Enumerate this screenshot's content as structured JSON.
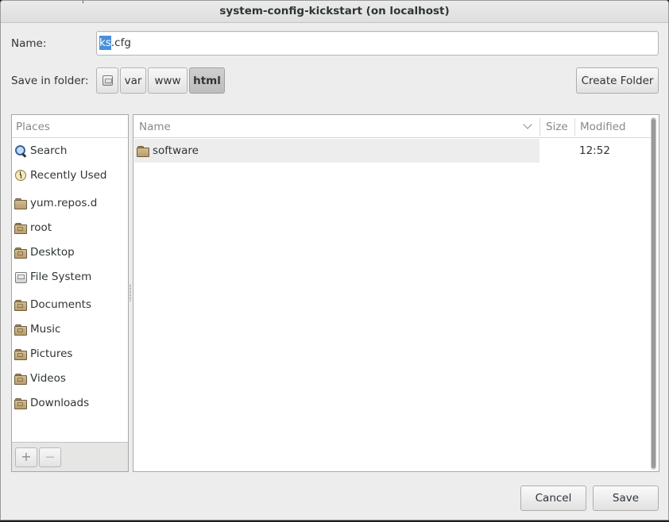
{
  "window": {
    "title": "system-config-kickstart (on localhost)"
  },
  "name_field": {
    "label": "Name:",
    "selected": "ks",
    "rest": ".cfg"
  },
  "save_in": {
    "label": "Save in folder:",
    "crumbs": [
      "var",
      "www",
      "html"
    ],
    "root_icon": "drive-icon",
    "active": "html"
  },
  "create_folder_label": "Create Folder",
  "places": {
    "header": "Places",
    "items": [
      {
        "label": "Search",
        "icon": "search-icon"
      },
      {
        "label": "Recently Used",
        "icon": "clock-icon"
      },
      {
        "label": "yum.repos.d",
        "icon": "folder-icon"
      },
      {
        "label": "root",
        "icon": "home-folder-icon"
      },
      {
        "label": "Desktop",
        "icon": "desktop-folder-icon"
      },
      {
        "label": "File System",
        "icon": "drive-icon"
      },
      {
        "label": "Documents",
        "icon": "documents-folder-icon"
      },
      {
        "label": "Music",
        "icon": "music-folder-icon"
      },
      {
        "label": "Pictures",
        "icon": "pictures-folder-icon"
      },
      {
        "label": "Videos",
        "icon": "videos-folder-icon"
      },
      {
        "label": "Downloads",
        "icon": "downloads-folder-icon"
      }
    ],
    "add_label": "+",
    "remove_label": "—"
  },
  "files": {
    "columns": {
      "name": "Name",
      "size": "Size",
      "modified": "Modified"
    },
    "rows": [
      {
        "name": "software",
        "size": "",
        "modified": "12:52",
        "icon": "folder-icon"
      }
    ]
  },
  "buttons": {
    "cancel": "Cancel",
    "save": "Save"
  },
  "colors": {
    "selection": "#4a90d9",
    "folder": "#c4ab7f"
  }
}
